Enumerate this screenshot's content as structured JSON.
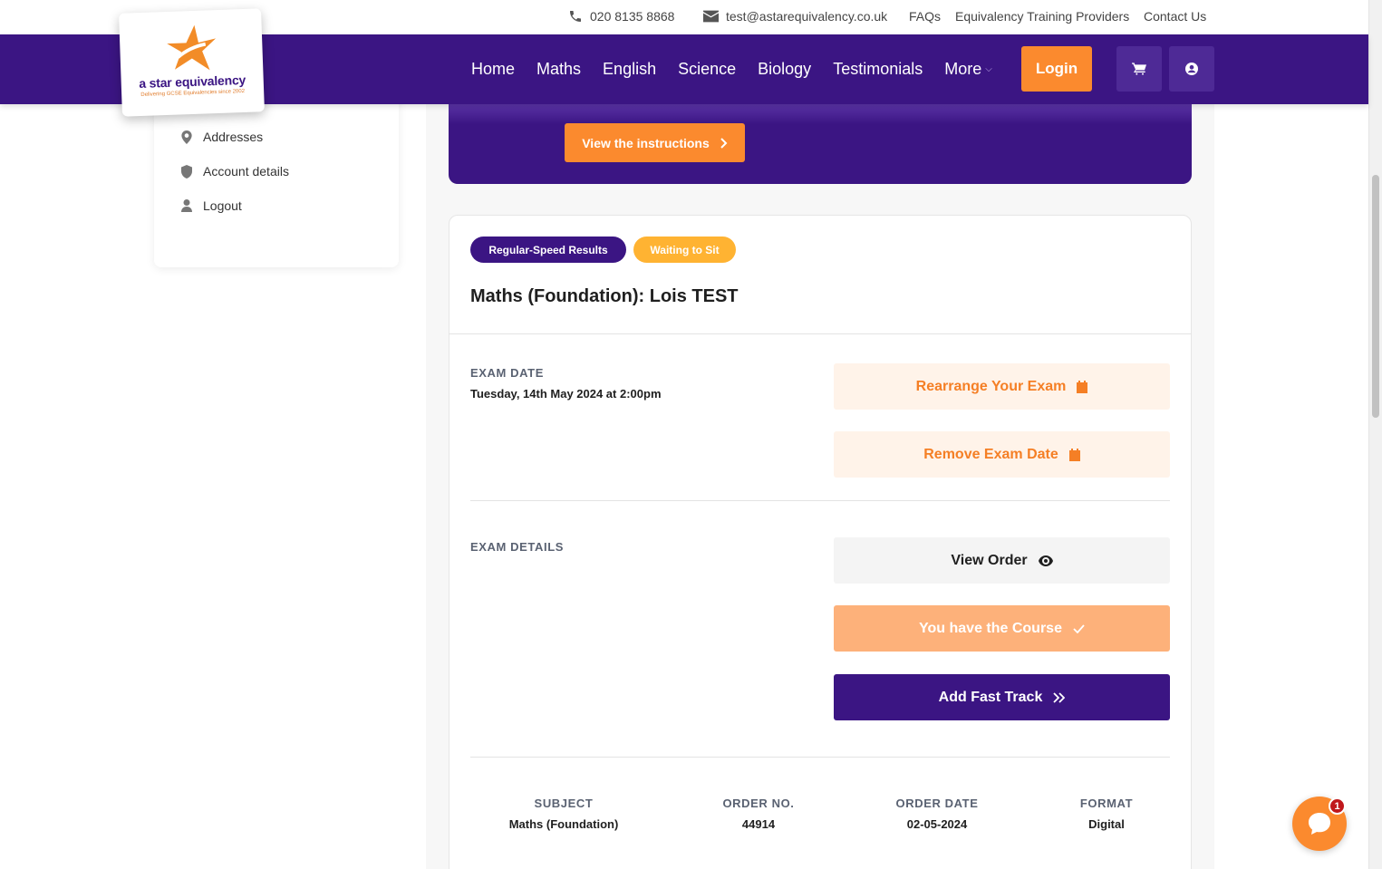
{
  "topbar": {
    "phone": "020 8135 8868",
    "email": "test@astarequivalency.co.uk",
    "links": [
      "FAQs",
      "Equivalency Training Providers",
      "Contact Us"
    ]
  },
  "logo": {
    "name": "a star equivalency",
    "tagline": "Delivering GCSE Equivalencies since 2002"
  },
  "nav": {
    "items": [
      "Home",
      "Maths",
      "English",
      "Science",
      "Biology",
      "Testimonials",
      "More"
    ],
    "login_label": "Login",
    "cart_icon": "cart-icon",
    "account_icon": "user-circle-icon"
  },
  "sidebar": {
    "items": [
      {
        "label": "Addresses",
        "icon": "map-pin-icon"
      },
      {
        "label": "Account details",
        "icon": "shield-icon"
      },
      {
        "label": "Logout",
        "icon": "user-icon"
      }
    ]
  },
  "banner": {
    "instructions_label": "View the instructions"
  },
  "exam": {
    "badges": [
      "Regular-Speed Results",
      "Waiting to Sit"
    ],
    "title": "Maths (Foundation): Lois TEST",
    "exam_date_label": "EXAM DATE",
    "exam_date_value": "Tuesday, 14th May 2024 at 2:00pm",
    "rearrange_label": "Rearrange Your Exam",
    "remove_label": "Remove Exam Date",
    "exam_details_label": "EXAM DETAILS",
    "view_order_label": "View Order",
    "course_label": "You have the Course",
    "fast_track_label": "Add Fast Track",
    "meta": [
      {
        "header": "SUBJECT",
        "value": "Maths (Foundation)"
      },
      {
        "header": "ORDER NO.",
        "value": "44914"
      },
      {
        "header": "ORDER DATE",
        "value": "02-05-2024"
      },
      {
        "header": "FORMAT",
        "value": "Digital"
      }
    ]
  },
  "chat": {
    "unread_count": "1"
  },
  "colors": {
    "brand_purple": "#3b1583",
    "brand_orange": "#fb8a2e",
    "badge_yellow": "#ffb332"
  }
}
